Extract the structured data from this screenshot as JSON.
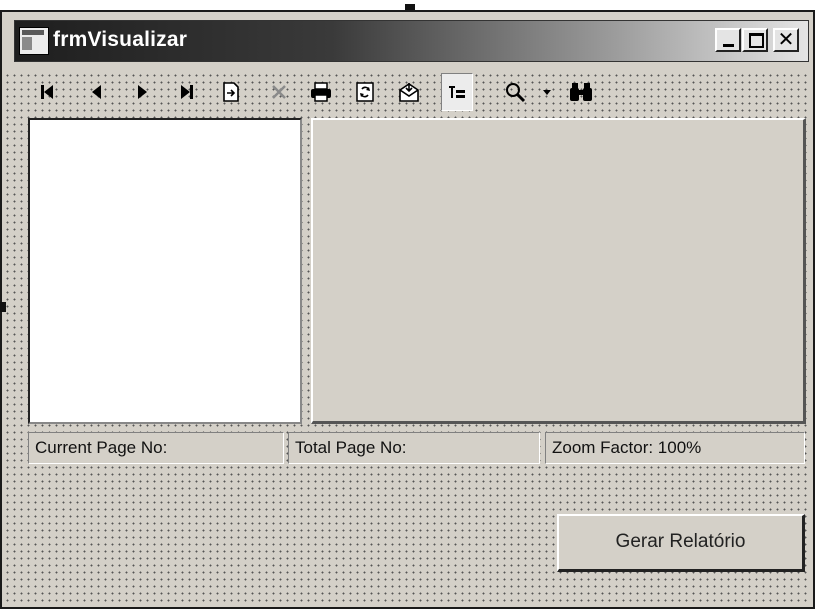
{
  "window": {
    "title": "frmVisualizar"
  },
  "toolbar": {
    "buttons": [
      {
        "name": "first-page",
        "glyph": "⏮"
      },
      {
        "name": "previous-page",
        "glyph": "◀"
      },
      {
        "name": "next-page",
        "glyph": "▶"
      },
      {
        "name": "last-page",
        "glyph": "⏭"
      },
      {
        "name": "goto-page",
        "glyph": "⇥"
      },
      {
        "name": "close-view",
        "glyph": "✕"
      },
      {
        "name": "print",
        "glyph": "🖶"
      },
      {
        "name": "refresh",
        "glyph": "↻"
      },
      {
        "name": "export",
        "glyph": "✉"
      },
      {
        "name": "toggle-group-tree",
        "glyph": "☰"
      },
      {
        "name": "zoom",
        "glyph": "⚲"
      },
      {
        "name": "zoom-dropdown",
        "glyph": "▾"
      },
      {
        "name": "search-text",
        "glyph": "🔭"
      }
    ]
  },
  "status": {
    "current_page": "Current Page No:",
    "total_page": "Total Page No:",
    "zoom_factor": "Zoom Factor: 100%"
  },
  "actions": {
    "generate_report": "Gerar Relatório"
  }
}
